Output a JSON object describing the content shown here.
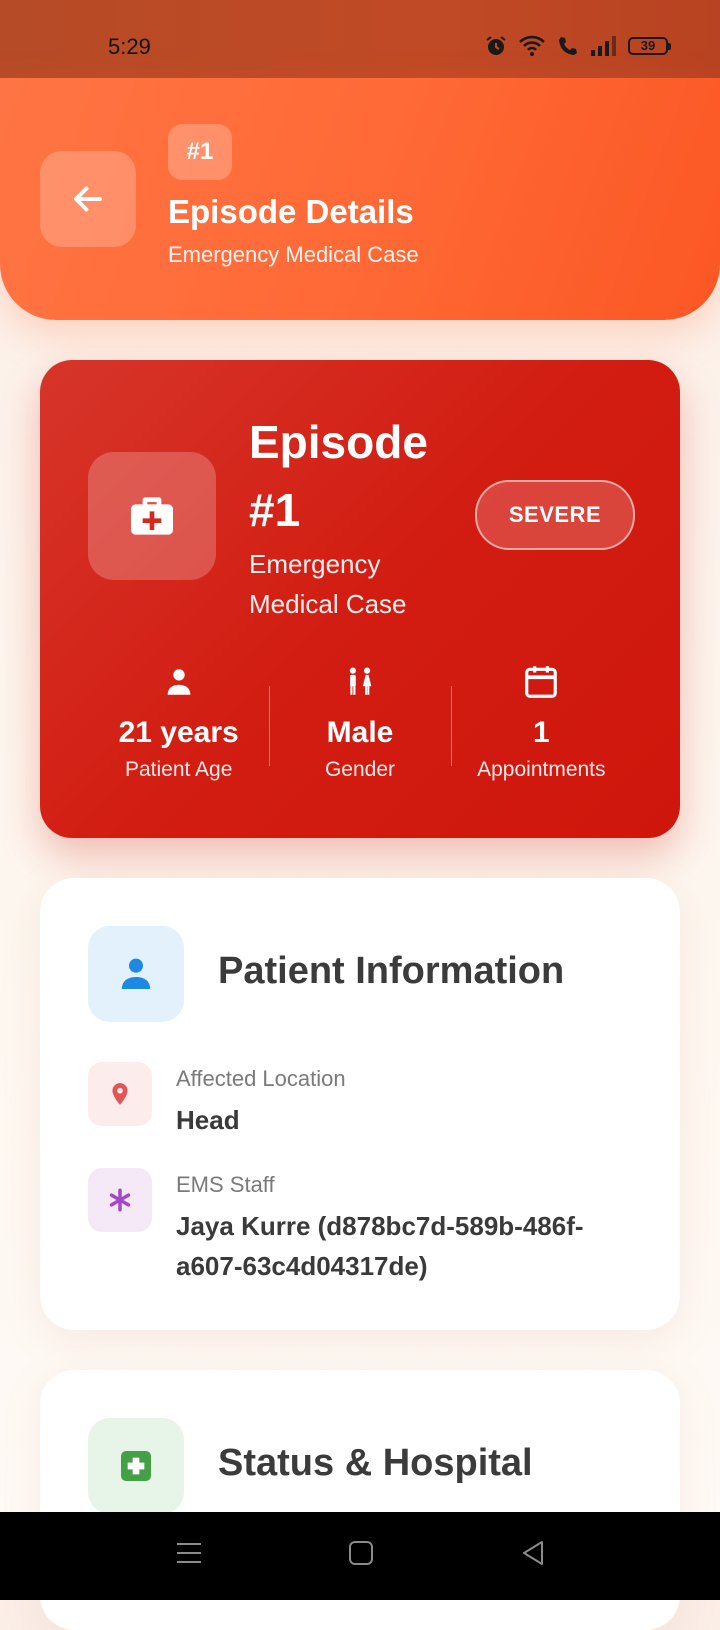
{
  "status_bar": {
    "time": "5:29",
    "battery": "39"
  },
  "header": {
    "episode_chip": "#1",
    "title": "Episode Details",
    "subtitle": "Emergency Medical Case"
  },
  "summary": {
    "title_line1": "Episode",
    "title_line2": "#1",
    "subtitle_line1": "Emergency",
    "subtitle_line2": "Medical Case",
    "severity": "SEVERE",
    "stats": [
      {
        "value": "21 years",
        "label": "Patient Age",
        "icon": "person-icon"
      },
      {
        "value": "Male",
        "label": "Gender",
        "icon": "gender-icon"
      },
      {
        "value": "1",
        "label": "Appointments",
        "icon": "calendar-icon"
      }
    ]
  },
  "patient_info": {
    "title": "Patient Information",
    "rows": [
      {
        "label": "Affected Location",
        "value": "Head",
        "icon": "location-pin-icon",
        "color": "#e25555"
      },
      {
        "label": "EMS Staff",
        "value": "Jaya Kurre (d878bc7d-589b-486f-a607-63c4d04317de)",
        "icon": "asterisk-icon",
        "color": "#a347c9"
      }
    ]
  },
  "status_hospital": {
    "title": "Status & Hospital"
  },
  "colors": {
    "header": "#ff6a36",
    "summary": "#d21d12",
    "patient_icon": "#1e88e5",
    "status_icon": "#43a047"
  }
}
